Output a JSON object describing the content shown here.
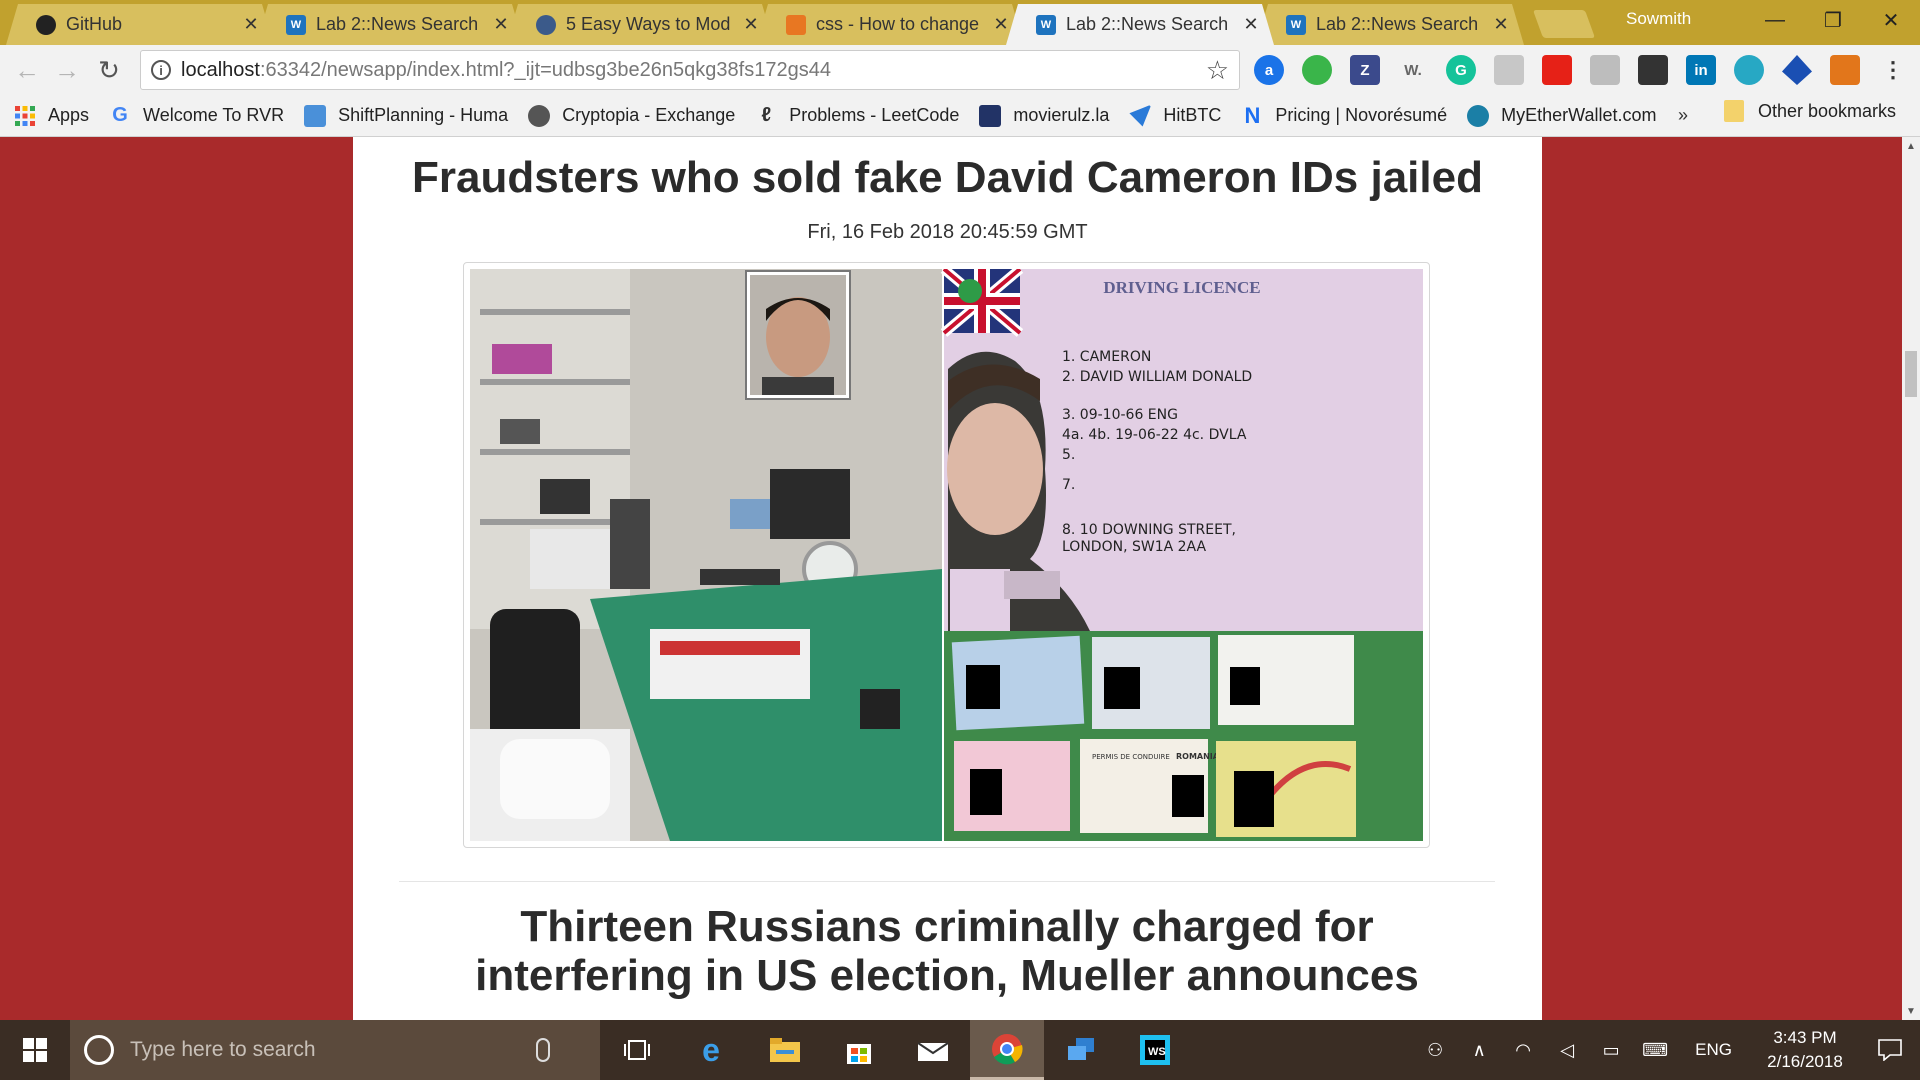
{
  "browser": {
    "tabs": [
      {
        "title": "GitHub",
        "icon": "github-icon",
        "active": false
      },
      {
        "title": "Lab 2::News Search",
        "icon": "webstorm-icon",
        "active": false
      },
      {
        "title": "5 Easy Ways to Mod",
        "icon": "page-icon",
        "active": false
      },
      {
        "title": "css - How to change",
        "icon": "stackoverflow-icon",
        "active": false
      },
      {
        "title": "Lab 2::News Search",
        "icon": "webstorm-icon",
        "active": true
      },
      {
        "title": "Lab 2::News Search",
        "icon": "webstorm-icon",
        "active": false
      }
    ],
    "profile_name": "Sowmith",
    "url_host": "localhost",
    "url_rest": ":63342/newsapp/index.html?_ijt=udbsg3be26n5qkg38fs172gs44",
    "extensions": [
      "a",
      "",
      "Z",
      "W.",
      "G",
      "",
      "",
      "",
      "",
      "",
      "in",
      "",
      "",
      ""
    ],
    "bookmarks": [
      {
        "label": "Apps",
        "icon": "apps-grid-icon",
        "color": "#4285f4"
      },
      {
        "label": "Welcome To RVR",
        "icon": "google-icon",
        "color": "#ffffff"
      },
      {
        "label": "ShiftPlanning - Huma",
        "icon": "person-icon",
        "color": "#4a90d9"
      },
      {
        "label": "Cryptopia - Exchange",
        "icon": "cryptopia-icon",
        "color": "#555555"
      },
      {
        "label": "Problems - LeetCode",
        "icon": "leetcode-icon",
        "color": "#f0a500"
      },
      {
        "label": "movierulz.la",
        "icon": "movie-icon",
        "color": "#223366"
      },
      {
        "label": "HitBTC",
        "icon": "hitbtc-icon",
        "color": "#2a7ad8"
      },
      {
        "label": "Pricing | Novorésumé",
        "icon": "novoresume-icon",
        "color": "#1d6ff2"
      },
      {
        "label": "MyEtherWallet.com",
        "icon": "myetherwallet-icon",
        "color": "#1b7fa6"
      }
    ],
    "bookmarks_more": "»",
    "other_bookmarks": "Other bookmarks"
  },
  "page": {
    "articles": [
      {
        "title": "Fraudsters who sold fake David Cameron IDs jailed",
        "date": "Fri, 16 Feb 2018 20:45:59 GMT",
        "image": {
          "licence_heading": "DRIVING LICENCE",
          "licence_lines": [
            "1.  CAMERON",
            "2.  DAVID WILLIAM DONALD",
            "3.  09-10-66  ENG",
            "4a.        4b. 19-06-22    4c. DVLA",
            "5.",
            "7.",
            "8.  10 DOWNING STREET,",
            "     LONDON, SW1A 2AA"
          ],
          "secondary_card_headings": [
            "PERMIS DE CONDUIRE",
            "ROMANIA"
          ]
        }
      },
      {
        "title": "Thirteen Russians criminally charged for interfering in US election, Mueller announces"
      }
    ],
    "background_color": "#a92a2b"
  },
  "taskbar": {
    "search_placeholder": "Type here to search",
    "language": "ENG",
    "time": "3:43 PM",
    "date": "2/16/2018"
  }
}
